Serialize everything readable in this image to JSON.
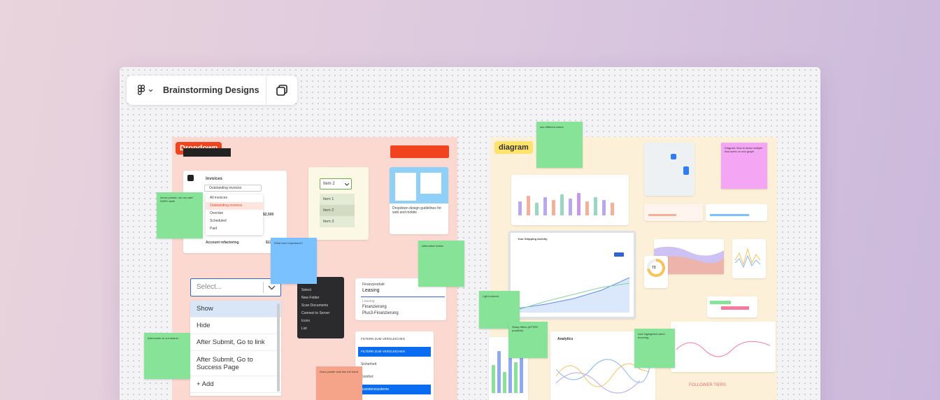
{
  "toolbar": {
    "title": "Brainstorming Designs",
    "logo_icon": "figma-icon",
    "chevron_icon": "chevron-down-icon",
    "copy_icon": "copy-icon"
  },
  "left_frame": {
    "tag": "Dropdown",
    "invoices": {
      "title": "Invoices",
      "select": "Outstanding invoices",
      "menu": [
        "All invoices",
        "Outstanding invoices",
        "Overdue",
        "Scheduled",
        "Paid"
      ],
      "amount": "$2,500",
      "row_label": "Account refactoring",
      "row_amount": "$17"
    },
    "select_box": {
      "placeholder": "Select...",
      "options": [
        "Show",
        "Hide",
        "After Submit, Go to link",
        "After Submit, Go to Success Page",
        "+ Add"
      ]
    },
    "item_list": {
      "label": "Label",
      "selected": "Item 2",
      "items": [
        "Item 1",
        "Item 2",
        "Item 3"
      ]
    },
    "dark_menu": {
      "items": [
        "Select",
        "New Folder",
        "Scan Documents",
        "Connect to Server",
        "Icons",
        "List"
      ]
    },
    "finance": {
      "label": "Finanzprodukt",
      "value": "Leasing",
      "options": [
        "Leasing",
        "Finanzierung",
        "Plus3-Finanzierung"
      ]
    },
    "filter": {
      "header": "FILTERN ZUM VERGLEICHEN",
      "items": [
        "Sicherheit",
        "Komfort",
        "Assistenzsysteme"
      ]
    },
    "guideline": {
      "title": "Dropdown design guidelines for web and mobile"
    },
    "stickies": {
      "a": "Arrow pointer: we can add DARK state",
      "b": "What form impression?",
      "c": "Alternative button",
      "d": "Add border to cut search",
      "e": "Does pointer look like the hand"
    }
  },
  "right_frame": {
    "tag": "diagram",
    "analytics_title": "Analytics",
    "donut_value": "73",
    "dashboard_title": "Your Shipping Activity",
    "followers": "FOLLOWER TIERS",
    "stickies": {
      "a": "use different colors",
      "b": "Diagram: flow to show multiple flow sizes on one graph",
      "c": "Light colored",
      "d": "Line highlighted when hovering",
      "e": "Sharp filters (AFTER possible)"
    }
  },
  "colors": {
    "accent_red": "#f0431e",
    "sticky_green": "#86e397",
    "sticky_blue": "#7ac2ff",
    "brand_blue": "#0a6cf1"
  }
}
